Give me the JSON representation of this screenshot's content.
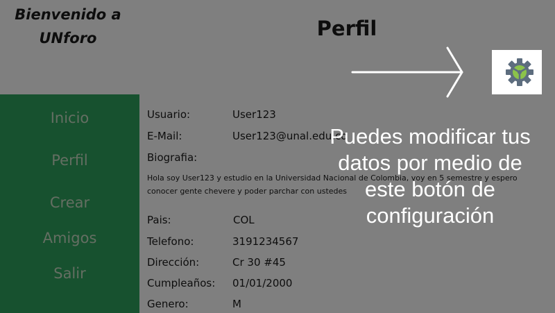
{
  "header": {
    "welcome_line1": "Bienvenido a",
    "welcome_line2": "UNforo",
    "page_title": "Perfil"
  },
  "sidebar": {
    "items": [
      {
        "label": "Inicio"
      },
      {
        "label": "Perfil"
      },
      {
        "label": "Crear"
      },
      {
        "label": "Amigos"
      },
      {
        "label": "Salir"
      }
    ]
  },
  "profile": {
    "usuario_label": "Usuario:",
    "usuario_value": "User123",
    "email_label": "E-Mail:",
    "email_value": "User123@unal.edu.co",
    "bio_label": "Biografia:",
    "bio_text": "Hola soy User123 y estudio en la Universidad Nacional de Colombia, voy en 5 semestre y espero conocer gente chevere y poder parchar con ustedes",
    "pais_label": "Pais:",
    "pais_value": "COL",
    "telefono_label": "Telefono:",
    "telefono_value": "3191234567",
    "direccion_label": "Dirección:",
    "direccion_value": "Cr 30 #45",
    "cumple_label": "Cumpleaños:",
    "cumple_value": "01/01/2000",
    "genero_label": "Genero:",
    "genero_value": "M"
  },
  "settings": {
    "icon": "gear-icon",
    "color": "#5d6d7e",
    "accent": "#8bc34a"
  },
  "tutorial": {
    "hint": "Puedes modificar tus datos por medio de este botón de configuración"
  },
  "colors": {
    "sidebar": "#2ea35f",
    "overlay": "rgba(0,0,0,0.5)"
  }
}
